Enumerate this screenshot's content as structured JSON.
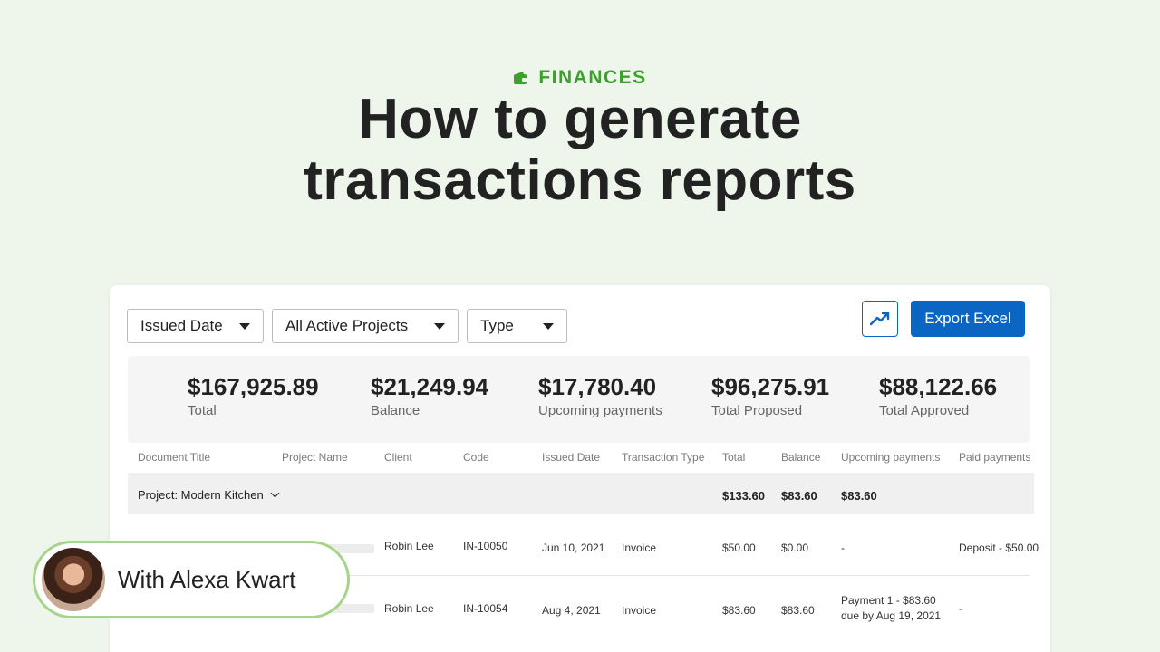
{
  "header": {
    "category": "FINANCES",
    "category_icon": "wallet-icon",
    "title_line1": "How to generate",
    "title_line2": "transactions reports"
  },
  "filters": [
    {
      "label": "Issued Date"
    },
    {
      "label": "All Active Projects"
    },
    {
      "label": "Type"
    }
  ],
  "toolbar": {
    "chart_icon": "trend-chart-icon",
    "export_label": "Export Excel"
  },
  "summary": [
    {
      "value": "$167,925.89",
      "label": "Total"
    },
    {
      "value": "$21,249.94",
      "label": "Balance"
    },
    {
      "value": "$17,780.40",
      "label": "Upcoming payments"
    },
    {
      "value": "$96,275.91",
      "label": "Total Proposed"
    },
    {
      "value": "$88,122.66",
      "label": "Total Approved"
    }
  ],
  "table": {
    "columns": [
      "Document Title",
      "Project Name",
      "Client",
      "Code",
      "Issued Date",
      "Transaction Type",
      "Total",
      "Balance",
      "Upcoming payments",
      "Paid payments"
    ],
    "group": {
      "label": "Project: Modern Kitchen",
      "total": "$133.60",
      "balance": "$83.60",
      "upcoming": "$83.60"
    },
    "rows": [
      {
        "client": "Robin Lee",
        "code": "IN-10050",
        "issued": "Jun 10, 2021",
        "type": "Invoice",
        "total": "$50.00",
        "balance": "$0.00",
        "upcoming": "-",
        "upcoming2": "",
        "paid": "Deposit - $50.00"
      },
      {
        "client": "Robin Lee",
        "code": "IN-10054",
        "issued": "Aug 4, 2021",
        "type": "Invoice",
        "total": "$83.60",
        "balance": "$83.60",
        "upcoming": "Payment 1 - $83.60",
        "upcoming2": "due by Aug 19, 2021",
        "paid": "-"
      }
    ]
  },
  "presenter": {
    "name": "With Alexa Kwart"
  },
  "colors": {
    "background": "#eef6ec",
    "accent_green": "#3aa12a",
    "primary_blue": "#0a66c2",
    "presenter_border": "#a6d48a"
  }
}
